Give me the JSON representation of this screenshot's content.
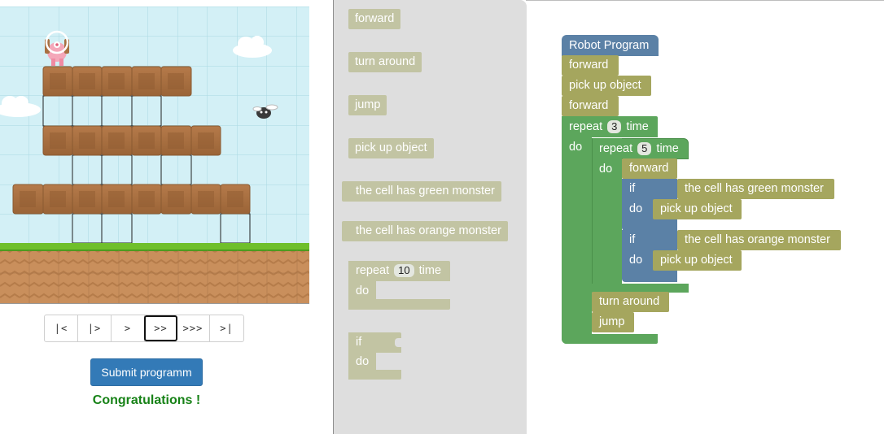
{
  "controls": {
    "buttons": [
      {
        "label": "|<"
      },
      {
        "label": "|>"
      },
      {
        "label": ">"
      },
      {
        "label": ">>",
        "active": true
      },
      {
        "label": ">>>"
      },
      {
        "label": ">|"
      }
    ]
  },
  "submit_label": "Submit programm",
  "status_message": "Congratulations !",
  "colors": {
    "sky": "#d3f0f6",
    "brick": "#a87042",
    "grass": "#6fbf2b",
    "soil": "#c98f5c",
    "toolbox_bg": "#dedede",
    "block_olive": "#a5a65e",
    "block_blue": "#5b81a6",
    "block_green": "#5ca65c",
    "submit_bg": "#337ab7",
    "success_text": "#178217"
  },
  "toolbox": {
    "forward": "forward",
    "turn_around": "turn around",
    "jump": "jump",
    "pick_up_object": "pick up object",
    "green_monster": "the cell has green monster",
    "orange_monster": "the cell has orange monster",
    "repeat_prefix": "repeat",
    "repeat_value": "10",
    "repeat_suffix": "time",
    "do_label": "do",
    "if_label": "if"
  },
  "program": {
    "title": "Robot Program",
    "s1": "forward",
    "s2": "pick up object",
    "s3": "forward",
    "outer_repeat_prefix": "repeat",
    "outer_repeat_value": "3",
    "outer_repeat_suffix": "time",
    "outer_do": "do",
    "inner_repeat_prefix": "repeat",
    "inner_repeat_value": "5",
    "inner_repeat_suffix": "time",
    "inner_do": "do",
    "inner_forward": "forward",
    "if1_label": "if",
    "if1_condition": "the cell has green monster",
    "if1_do": "do",
    "if1_action": "pick up object",
    "if2_label": "if",
    "if2_condition": "the cell has orange monster",
    "if2_do": "do",
    "if2_action": "pick up object",
    "after1": "turn around",
    "after2": "jump"
  }
}
